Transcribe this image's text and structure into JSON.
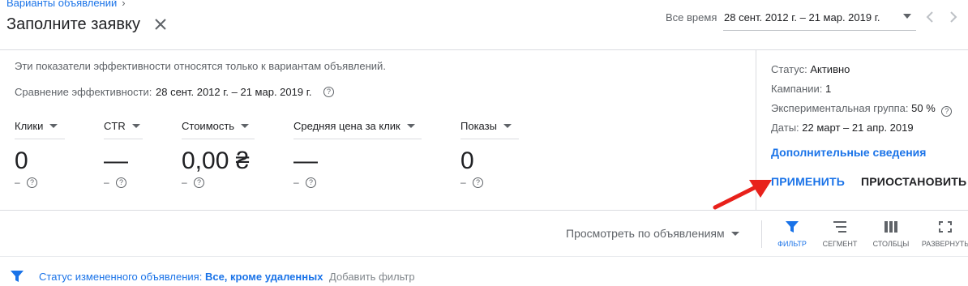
{
  "header": {
    "breadcrumb": "Варианты объявлений",
    "breadcrumb_sep": "›",
    "title": "Заполните заявку",
    "range_label": "Все время",
    "range_value": "28 сент. 2012 г. – 21 мар. 2019 г."
  },
  "performance": {
    "note": "Эти показатели эффективности относятся только к вариантам объявлений.",
    "compare_label": "Сравнение эффективности:",
    "compare_value": "28 сент. 2012 г. – 21 мар. 2019 г.",
    "metrics": [
      {
        "label": "Клики",
        "value": "0",
        "sub": "–"
      },
      {
        "label": "CTR",
        "value": "—",
        "sub": "–"
      },
      {
        "label": "Стоимость",
        "value": "0,00 ₴",
        "sub": "–"
      },
      {
        "label": "Средняя цена за клик",
        "value": "—",
        "sub": "–"
      },
      {
        "label": "Показы",
        "value": "0",
        "sub": "–"
      }
    ]
  },
  "details": {
    "status_label": "Статус:",
    "status_value": "Активно",
    "campaigns_label": "Кампании:",
    "campaigns_value": "1",
    "group_label": "Экспериментальная группа:",
    "group_value": "50 %",
    "dates_label": "Даты:",
    "dates_value": "22 март – 21 апр. 2019",
    "more_link": "Дополнительные сведения",
    "apply": "ПРИМЕНИТЬ",
    "pause": "ПРИОСТАНОВИТЬ"
  },
  "toolbar": {
    "view_by": "Просмотреть по объявлениям",
    "filter": "ФИЛЬТР",
    "segment": "СЕГМЕНТ",
    "columns": "СТОЛБЦЫ",
    "expand": "РАЗВЕРНУТЬ"
  },
  "filter_bar": {
    "label": "Статус измененного объявления:",
    "value": "Все, кроме удаленных",
    "add": "Добавить фильтр"
  },
  "colors": {
    "accent": "#1a73e8",
    "arrow": "#e8211b",
    "text": "#202124",
    "muted": "#5f6368"
  },
  "icons": [
    "close-icon",
    "dropdown-icon",
    "chevron-left-icon",
    "chevron-right-icon",
    "help-icon",
    "filter-icon",
    "segment-icon",
    "columns-icon",
    "expand-icon"
  ]
}
